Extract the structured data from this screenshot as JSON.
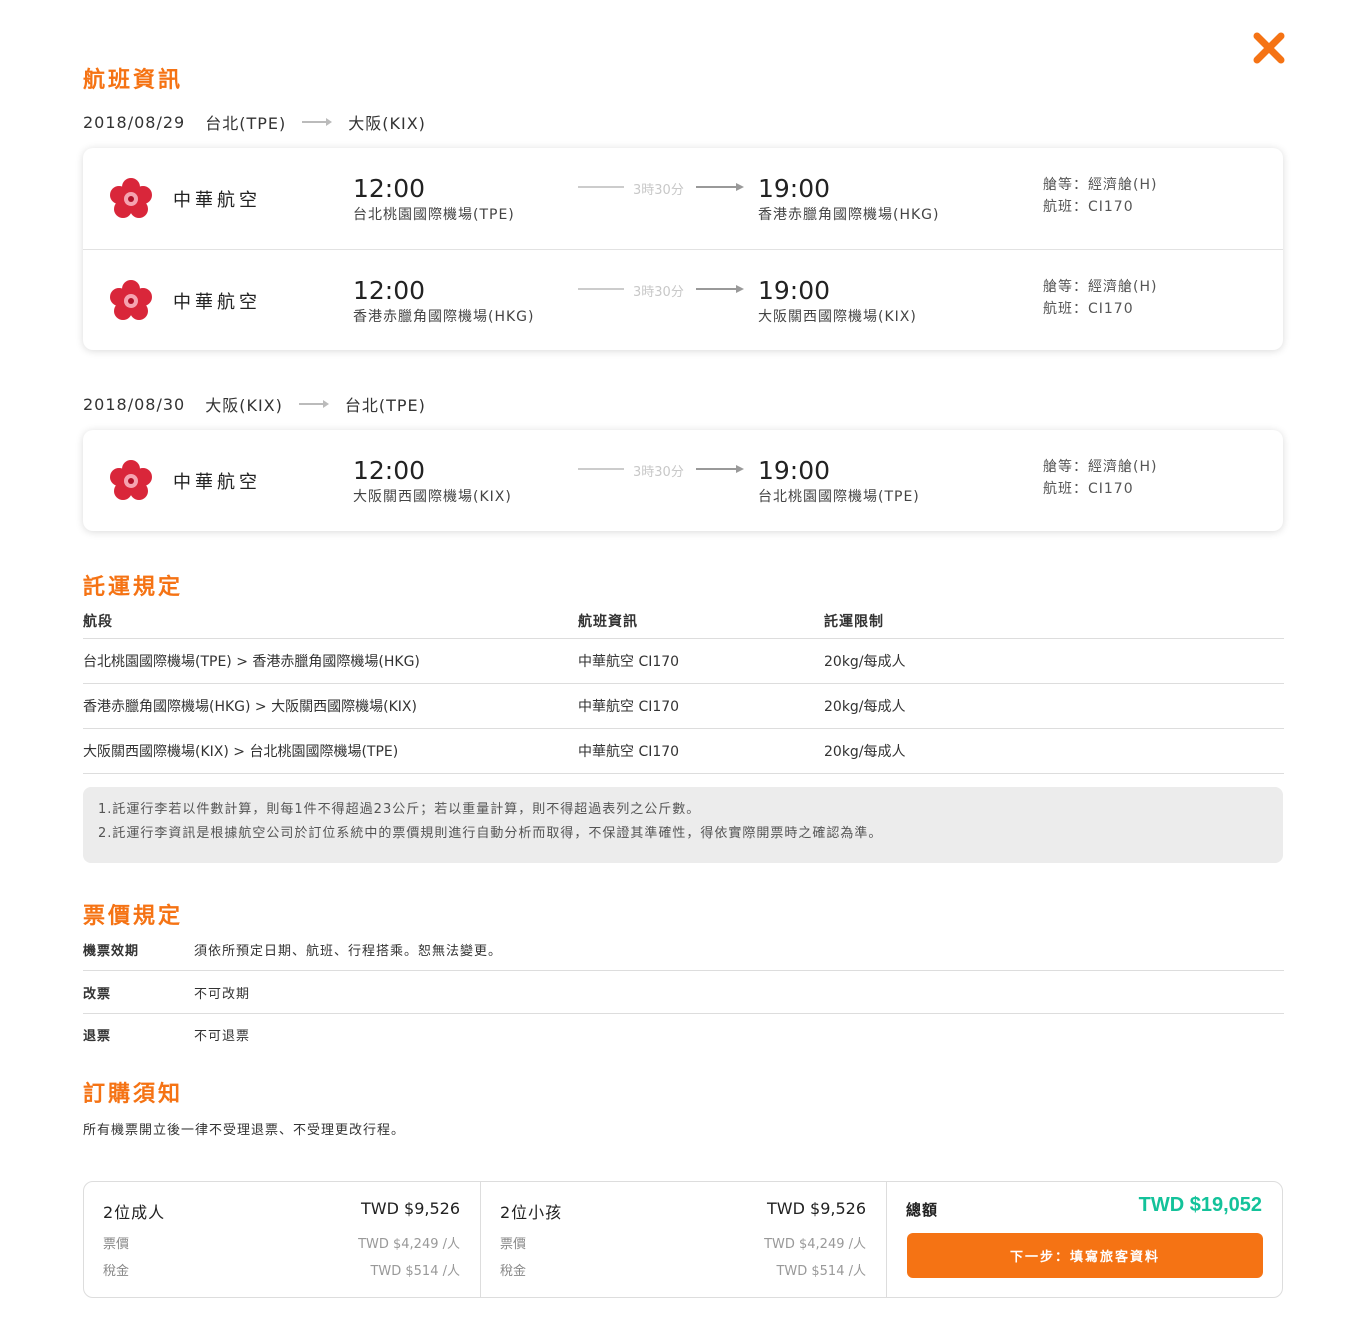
{
  "titles": {
    "flight_info": "航班資訊",
    "baggage": "託運規定",
    "fare_rules": "票價規定",
    "booking_notice": "訂購須知"
  },
  "colors": {
    "accent": "#f57314",
    "total": "#13c29a"
  },
  "journeys": [
    {
      "date": "2018/08/29",
      "from": "台北(TPE)",
      "to": "大阪(KIX)",
      "segments": [
        {
          "airline": "中華航空",
          "dep_time": "12:00",
          "dep_airport": "台北桃園國際機場(TPE)",
          "duration": "3時30分",
          "arr_time": "19:00",
          "arr_airport": "香港赤臘角國際機場(HKG)",
          "cabin": "艙等：經濟艙(H)",
          "flight": "航班：CI170"
        },
        {
          "airline": "中華航空",
          "dep_time": "12:00",
          "dep_airport": "香港赤臘角國際機場(HKG)",
          "duration": "3時30分",
          "arr_time": "19:00",
          "arr_airport": "大阪關西國際機場(KIX)",
          "cabin": "艙等：經濟艙(H)",
          "flight": "航班：CI170"
        }
      ]
    },
    {
      "date": "2018/08/30",
      "from": "大阪(KIX)",
      "to": "台北(TPE)",
      "segments": [
        {
          "airline": "中華航空",
          "dep_time": "12:00",
          "dep_airport": "大阪關西國際機場(KIX)",
          "duration": "3時30分",
          "arr_time": "19:00",
          "arr_airport": "台北桃園國際機場(TPE)",
          "cabin": "艙等：經濟艙(H)",
          "flight": "航班：CI170"
        }
      ]
    }
  ],
  "baggage": {
    "headers": [
      "航段",
      "航班資訊",
      "託運限制"
    ],
    "rows": [
      [
        "台北桃園國際機場(TPE) > 香港赤臘角國際機場(HKG)",
        "中華航空 CI170",
        "20kg/每成人"
      ],
      [
        "香港赤臘角國際機場(HKG) > 大阪關西國際機場(KIX)",
        "中華航空 CI170",
        "20kg/每成人"
      ],
      [
        "大阪關西國際機場(KIX) > 台北桃園國際機場(TPE)",
        "中華航空 CI170",
        "20kg/每成人"
      ]
    ],
    "notes": [
      "1.託運行李若以件數計算，則每1件不得超過23公斤；若以重量計算，則不得超過表列之公斤數。",
      "2.託運行李資訊是根據航空公司於訂位系統中的票價規則進行自動分析而取得，不保證其準確性，得依實際開票時之確認為準。"
    ]
  },
  "fare_rules": [
    {
      "key": "機票效期",
      "value": "須依所預定日期、航班、行程搭乘。恕無法變更。"
    },
    {
      "key": "改票",
      "value": "不可改期"
    },
    {
      "key": "退票",
      "value": "不可退票"
    }
  ],
  "booking_notice": "所有機票開立後一律不受理退票、不受理更改行程。",
  "price": {
    "adult": {
      "title": "2位成人",
      "amount": "TWD $9,526",
      "fare_label": "票價",
      "fare": "TWD $4,249 /人",
      "tax_label": "稅金",
      "tax": "TWD $514 /人"
    },
    "child": {
      "title": "2位小孩",
      "amount": "TWD $9,526",
      "fare_label": "票價",
      "fare": "TWD $4,249 /人",
      "tax_label": "稅金",
      "tax": "TWD $514 /人"
    },
    "total_label": "總額",
    "total": "TWD $19,052",
    "next_button": "下一步：填寫旅客資料"
  }
}
